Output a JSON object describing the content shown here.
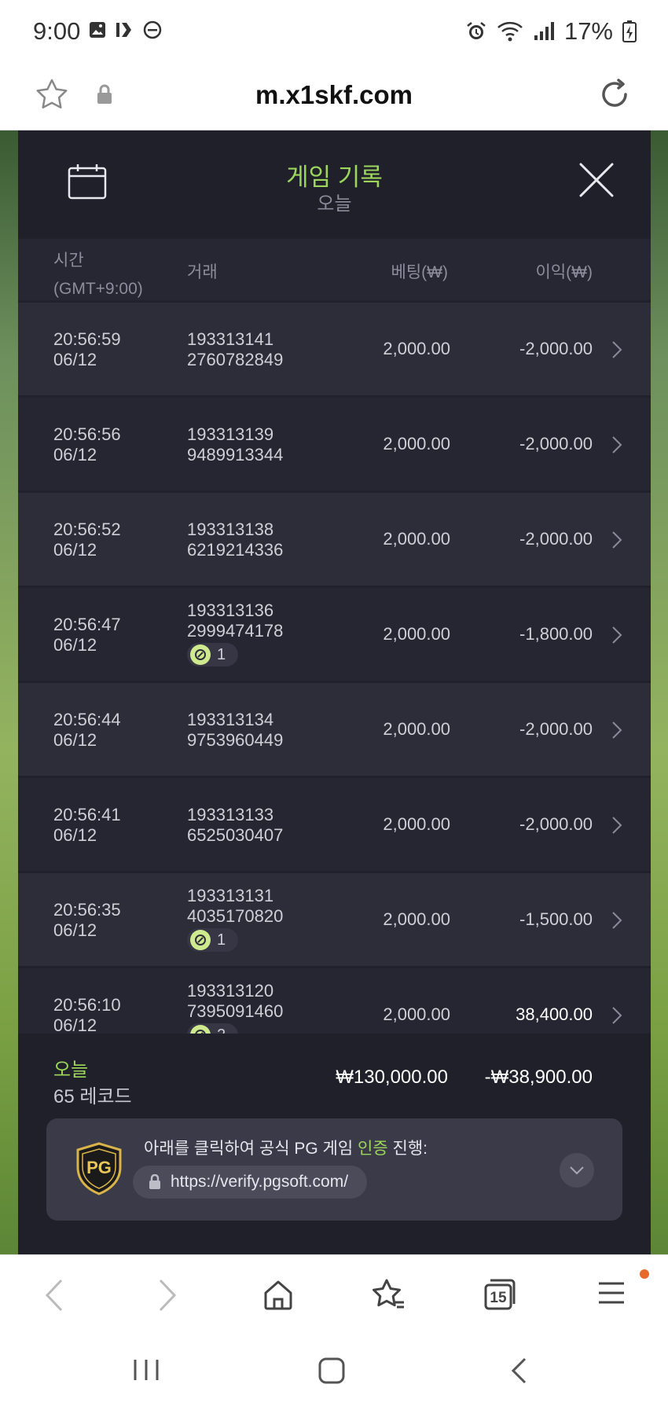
{
  "status": {
    "time": "9:00",
    "battery": "17%"
  },
  "browser": {
    "url": "m.x1skf.com",
    "tab_count": "15"
  },
  "panel": {
    "title": "게임 기록",
    "subtitle": "오늘",
    "columns": {
      "time": "시간",
      "timezone": "(GMT+9:00)",
      "trade": "거래",
      "bet": "베팅(₩)",
      "profit": "이익(₩)"
    }
  },
  "rows": [
    {
      "time": "20:56:59",
      "date": "06/12",
      "id1": "193313141",
      "id2": "2760782849",
      "badge": "",
      "bet": "2,000.00",
      "profit": "-2,000.00"
    },
    {
      "time": "20:56:56",
      "date": "06/12",
      "id1": "193313139",
      "id2": "9489913344",
      "badge": "",
      "bet": "2,000.00",
      "profit": "-2,000.00"
    },
    {
      "time": "20:56:52",
      "date": "06/12",
      "id1": "193313138",
      "id2": "6219214336",
      "badge": "",
      "bet": "2,000.00",
      "profit": "-2,000.00"
    },
    {
      "time": "20:56:47",
      "date": "06/12",
      "id1": "193313136",
      "id2": "2999474178",
      "badge": "1",
      "bet": "2,000.00",
      "profit": "-1,800.00"
    },
    {
      "time": "20:56:44",
      "date": "06/12",
      "id1": "193313134",
      "id2": "9753960449",
      "badge": "",
      "bet": "2,000.00",
      "profit": "-2,000.00"
    },
    {
      "time": "20:56:41",
      "date": "06/12",
      "id1": "193313133",
      "id2": "6525030407",
      "badge": "",
      "bet": "2,000.00",
      "profit": "-2,000.00"
    },
    {
      "time": "20:56:35",
      "date": "06/12",
      "id1": "193313131",
      "id2": "4035170820",
      "badge": "1",
      "bet": "2,000.00",
      "profit": "-1,500.00"
    },
    {
      "time": "20:56:10",
      "date": "06/12",
      "id1": "193313120",
      "id2": "7395091460",
      "badge": "2",
      "bet": "2,000.00",
      "profit": "38,400.00"
    }
  ],
  "summary": {
    "label": "오늘",
    "count": "65 레코드",
    "total_bet": "₩130,000.00",
    "total_profit": "-₩38,900.00"
  },
  "verify": {
    "text_before": "아래를 클릭하여 공식 PG 게임 ",
    "text_highlight": "인증",
    "text_after": " 진행:",
    "link": "https://verify.pgsoft.com/",
    "logo_text": "PG"
  },
  "colors": {
    "accent": "#9cd65c",
    "panel_bg": "#21212d",
    "row_odd": "#2d2d3a",
    "row_even": "#262632"
  }
}
